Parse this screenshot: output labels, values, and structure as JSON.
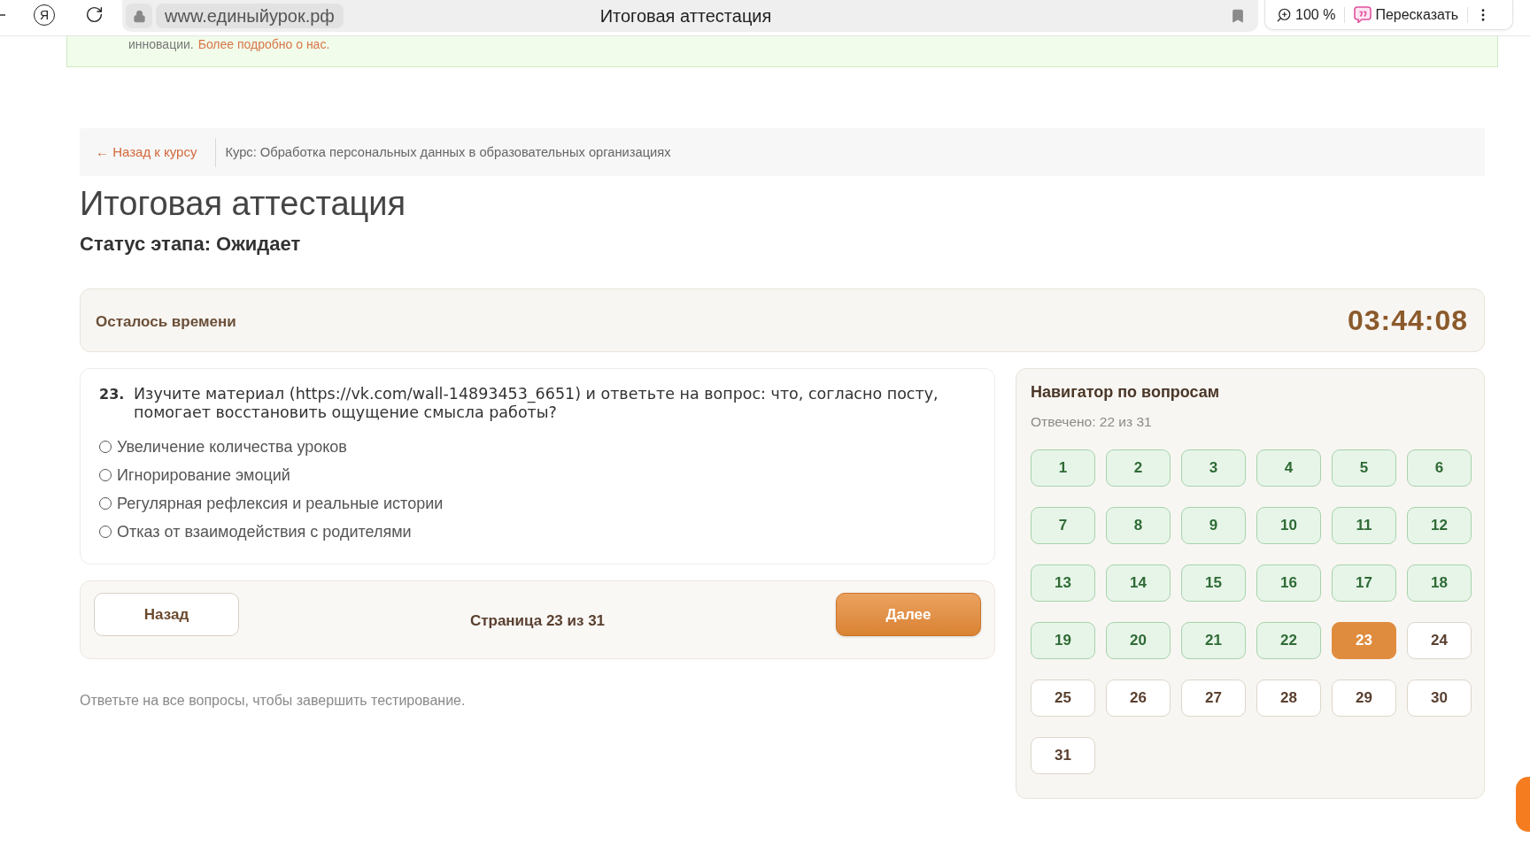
{
  "browser": {
    "logo": "Я",
    "url": "www.единыйурок.рф",
    "tab_title": "Итоговая аттестация",
    "zoom": "100 %",
    "summarize_button": "Пересказать"
  },
  "banner": {
    "text": "инновации.",
    "link": "Более подробно о нас."
  },
  "breadcrumb": {
    "back_link": "← Назад к курсу",
    "course": "Курс: Обработка персональных данных в образовательных организациях"
  },
  "title": "Итоговая аттестация",
  "status": "Статус этапа: Ожидает",
  "timer": {
    "label": "Осталось времени",
    "value": "03:44:08"
  },
  "question": {
    "number": "23.",
    "text": "Изучите материал (https://vk.com/wall-14893453_6651) и ответьте на вопрос: что, согласно посту, помогает восстановить ощущение смысла работы?",
    "options": [
      {
        "label": "Увеличение количества уроков",
        "selected": false
      },
      {
        "label": "Игнорирование эмоций",
        "selected": false
      },
      {
        "label": "Регулярная рефлексия и реальные истории",
        "selected": false
      },
      {
        "label": "Отказ от взаимодействия с родителями",
        "selected": false
      }
    ]
  },
  "pager": {
    "back_button": "Назад",
    "page": "Страница 23 из 31",
    "next_button": "Далее"
  },
  "hint": "Ответьте на все вопросы, чтобы завершить тестирование.",
  "navigator": {
    "title": "Навигатор по вопросам",
    "answered_count": "Отвечено: 22 из 31",
    "questions": [
      {
        "label": "1",
        "answered": true,
        "selected": false
      },
      {
        "label": "2",
        "answered": true,
        "selected": false
      },
      {
        "label": "3",
        "answered": true,
        "selected": false
      },
      {
        "label": "4",
        "answered": true,
        "selected": false
      },
      {
        "label": "5",
        "answered": true,
        "selected": false
      },
      {
        "label": "6",
        "answered": true,
        "selected": false
      },
      {
        "label": "7",
        "answered": true,
        "selected": false
      },
      {
        "label": "8",
        "answered": true,
        "selected": false
      },
      {
        "label": "9",
        "answered": true,
        "selected": false
      },
      {
        "label": "10",
        "answered": true,
        "selected": false
      },
      {
        "label": "11",
        "answered": true,
        "selected": false
      },
      {
        "label": "12",
        "answered": true,
        "selected": false
      },
      {
        "label": "13",
        "answered": true,
        "selected": false
      },
      {
        "label": "14",
        "answered": true,
        "selected": false
      },
      {
        "label": "15",
        "answered": true,
        "selected": false
      },
      {
        "label": "16",
        "answered": true,
        "selected": false
      },
      {
        "label": "17",
        "answered": true,
        "selected": false
      },
      {
        "label": "18",
        "answered": true,
        "selected": false
      },
      {
        "label": "19",
        "answered": true,
        "selected": false
      },
      {
        "label": "20",
        "answered": true,
        "selected": false
      },
      {
        "label": "21",
        "answered": true,
        "selected": false
      },
      {
        "label": "22",
        "answered": true,
        "selected": false
      },
      {
        "label": "23",
        "answered": false,
        "selected": true
      },
      {
        "label": "24",
        "answered": false,
        "selected": false
      },
      {
        "label": "25",
        "answered": false,
        "selected": false
      },
      {
        "label": "26",
        "answered": false,
        "selected": false
      },
      {
        "label": "27",
        "answered": false,
        "selected": false
      },
      {
        "label": "28",
        "answered": false,
        "selected": false
      },
      {
        "label": "29",
        "answered": false,
        "selected": false
      },
      {
        "label": "30",
        "answered": false,
        "selected": false
      },
      {
        "label": "31",
        "answered": false,
        "selected": false
      }
    ]
  }
}
